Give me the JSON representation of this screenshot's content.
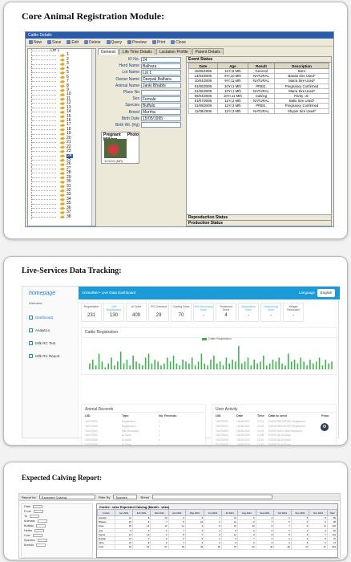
{
  "panel1": {
    "heading": "Core Animal Registration Module:",
    "window_title": "Cattle Details",
    "toolbar": [
      "New",
      "Save",
      "Edit",
      "Delete",
      "Query",
      "Preview",
      "Print",
      "Close"
    ],
    "tree_root": "Lot 1",
    "tree_items": [
      "1",
      "2",
      "3",
      "4",
      "5",
      "6",
      "7",
      "8",
      "9",
      "10",
      "11",
      "12",
      "13",
      "14",
      "15",
      "16",
      "17",
      "18",
      "19",
      "20",
      "21",
      "22",
      "23",
      "24",
      "25",
      "26",
      "27",
      "28",
      "29",
      "30",
      "31",
      "32",
      "33",
      "34",
      "35",
      "36",
      "37",
      "38"
    ],
    "tree_selected": "24",
    "tabs": [
      "General",
      "Life Time Details",
      "Lactation Profile",
      "Parent Details"
    ],
    "form": [
      {
        "label": "ID No.",
        "value": "24"
      },
      {
        "label": "Herd Name",
        "value": "Balhara"
      },
      {
        "label": "Lot Name",
        "value": "Lot 1"
      },
      {
        "label": "Owner Name",
        "value": "Deepak Balhara"
      },
      {
        "label": "Animal Name",
        "value": "Janki Bhabhi"
      },
      {
        "label": "Place No",
        "value": ""
      },
      {
        "label": "Sex",
        "value": "Female"
      },
      {
        "label": "Species",
        "value": "Buffalo"
      },
      {
        "label": "Breed",
        "value": "Murrha"
      },
      {
        "label": "Birth Date",
        "value": "15/05/1995"
      },
      {
        "label": "Birth Wt. (Kg)",
        "value": ""
      }
    ],
    "photo_headers": [
      "Pregnant Milking",
      "Photo"
    ],
    "photo_caption": "12/4/19 (MR)",
    "event_status_title": "Event Status",
    "event_columns": [
      "Date",
      "Age",
      "Result",
      "Description"
    ],
    "events": [
      [
        "15/05/1995",
        "11Yr,8 Mth",
        "General",
        "Born"
      ],
      [
        "14/03/2005",
        "9Yr,10 Mth",
        "NATURAL",
        "Banda Sire Used*"
      ],
      [
        "10/04/2005",
        "9Yr,11 Mth",
        "NATURAL",
        "Marra Sire Used*"
      ],
      [
        "01/06/2005",
        "10Yr,1 Mth",
        "PREG.",
        "Pregnancy Confirmed"
      ],
      [
        "01/06/2005",
        "10Yr,1 Mth",
        "NATURAL",
        "Marra Sire Used*"
      ],
      [
        "09/04/2006",
        "10Yr,11 Mth",
        "Calving",
        "Parity =5-"
      ],
      [
        "01/07/2006",
        "11Yr,2 Mth",
        "NATURAL",
        "Ballu Sire Used*"
      ],
      [
        "31/08/2006",
        "11Yr,3 Mth",
        "PREG.",
        "Pregnancy Confirmed"
      ],
      [
        "11/08/2006",
        "11Yr,3 Mth",
        "NATURAL",
        "Shyam Sire Used*"
      ]
    ],
    "reproduction_status": "Reproduction Status",
    "production_status": "Production Status"
  },
  "panel2": {
    "heading": "Live-Services Data Tracking:",
    "logo": "homepage",
    "welcome": "Welcome",
    "nav": [
      "Dashboard",
      "Analytics",
      "Milk RC Test",
      "Milk RC Report"
    ],
    "topbar_title": "AnimalNet • Live Data Dashboard",
    "language_label": "Language",
    "language_value": "English",
    "stats": [
      {
        "label": "Registration",
        "value": "231"
      },
      {
        "label": "Calf Registration",
        "value": "130"
      },
      {
        "label": "AI Done",
        "value": "409"
      },
      {
        "label": "PD Checked",
        "value": "29"
      },
      {
        "label": "Calving Done",
        "value": "70"
      },
      {
        "label": "Milk Recording Done",
        "value": "-"
      },
      {
        "label": "Treatment Done",
        "value": "4"
      },
      {
        "label": "Vaccination Done",
        "value": "-"
      },
      {
        "label": "Deworming Done",
        "value": "-"
      },
      {
        "label": "Weight Recorded",
        "value": "-"
      }
    ],
    "chart_title": "Cattle Registration",
    "chart_legend": "Cattle Registration",
    "records_title": "Animal Records",
    "records_columns": [
      "UID",
      "Type",
      "No. Records"
    ],
    "records_rows": [
      [
        "TAGT0001",
        "Registration",
        "1"
      ],
      [
        "TAGT0002",
        "Registration",
        "1"
      ],
      [
        "TAGT0003",
        "Milk Recorded",
        "1"
      ],
      [
        "TAGT0004",
        "AI Done",
        "1"
      ],
      [
        "TAGT0005",
        "AI Done",
        "1"
      ],
      [
        "TAGT0006",
        "AI Done",
        "1"
      ]
    ],
    "activity_title": "User Activity",
    "activity_columns": [
      "UID",
      "Date",
      "Time",
      "Data to send",
      "From"
    ],
    "activity_rows": [
      [
        "TAGT0001",
        "15/03/2020",
        "10:01",
        "EVENT/REGISTER Registered",
        ""
      ],
      [
        "TAGT0002",
        "15/03/2020",
        "10:03",
        "EVENT/REGISTER Registered",
        ""
      ],
      [
        "TAGT0003",
        "15/03/2020",
        "10:05",
        "EVENT/MILK Milk Recorded",
        ""
      ],
      [
        "TAGT0004",
        "15/03/2020",
        "10:08",
        "EVENT/AI AI Done",
        ""
      ],
      [
        "TAGT0005",
        "15/03/2020",
        "10:10",
        "EVENT/AI AI Done",
        ""
      ],
      [
        "TAGT0006",
        "15/03/2020",
        "10:12",
        "EVENT/AI AI Done",
        ""
      ]
    ],
    "fab_icon": "gear-icon"
  },
  "chart_data": {
    "type": "bar",
    "title": "Cattle Registration",
    "series": [
      {
        "name": "Cattle Registration",
        "values": [
          3,
          5,
          2,
          8,
          4,
          1,
          3,
          6,
          2,
          4,
          9,
          3,
          5,
          2,
          7,
          4,
          3,
          2,
          6,
          8,
          3,
          5,
          4,
          2,
          3,
          6,
          4,
          7,
          3,
          2,
          5,
          4,
          3,
          6,
          2,
          4,
          8,
          3,
          2,
          5,
          7,
          3,
          4,
          2,
          6,
          3,
          5,
          4,
          12,
          3,
          4,
          6,
          2,
          5,
          3,
          4,
          7,
          2,
          3,
          5,
          4,
          6,
          3,
          2,
          8,
          4,
          5,
          3,
          6,
          4,
          2,
          5,
          3,
          4,
          6,
          2,
          5,
          3,
          4
        ]
      }
    ],
    "ylim": [
      0,
      14
    ]
  },
  "panel3": {
    "heading": "Expected Calving Report:",
    "toolbar": {
      "report_for_label": "Report for",
      "report_for_value": "Expected Calving",
      "filter_label": "Filter By",
      "filter_value": "Species",
      "breed_label": "Breed"
    },
    "left_rows": [
      "Date",
      "From",
      "To",
      "Animals",
      "Buffalo",
      "Heifer",
      "Cow",
      "Species",
      "Breeds"
    ],
    "grid_title": "Centre - wise Expected Calving (Month - wise)",
    "grid_columns": [
      "Centre",
      "Jan 2021",
      "Feb 2021",
      "Mar 2021",
      "Apr 2021",
      "May 2021",
      "Jun 2021",
      "Jul 2021",
      "Aug 2021",
      "Sep 2021",
      "Oct 2021",
      "Nov 2021",
      "Dec 2021",
      "Total"
    ],
    "grid_rows": [
      [
        "Ambala",
        "12",
        "8",
        "10",
        "6",
        "9",
        "7",
        "11",
        "5",
        "4",
        "3",
        "6",
        "8",
        "89"
      ],
      [
        "Bhiwani",
        "15",
        "9",
        "7",
        "8",
        "10",
        "6",
        "12",
        "9",
        "7",
        "5",
        "4",
        "6",
        "98"
      ],
      [
        "Hisar",
        "20",
        "14",
        "12",
        "11",
        "9",
        "8",
        "15",
        "10",
        "6",
        "7",
        "9",
        "11",
        "132"
      ],
      [
        "Jind",
        "9",
        "6",
        "5",
        "7",
        "4",
        "3",
        "8",
        "6",
        "5",
        "2",
        "3",
        "4",
        "62"
      ],
      [
        "Karnal",
        "14",
        "10",
        "9",
        "8",
        "7",
        "6",
        "12",
        "9",
        "8",
        "5",
        "6",
        "7",
        "101"
      ],
      [
        "Rohtak",
        "11",
        "7",
        "8",
        "6",
        "5",
        "4",
        "9",
        "7",
        "6",
        "3",
        "4",
        "5",
        "75"
      ],
      [
        "Sirsa",
        "10",
        "8",
        "6",
        "7",
        "5",
        "6",
        "8",
        "6",
        "4",
        "3",
        "5",
        "6",
        "74"
      ],
      [
        "Total",
        "91",
        "62",
        "57",
        "53",
        "49",
        "40",
        "75",
        "52",
        "40",
        "28",
        "37",
        "47",
        "631"
      ]
    ]
  }
}
